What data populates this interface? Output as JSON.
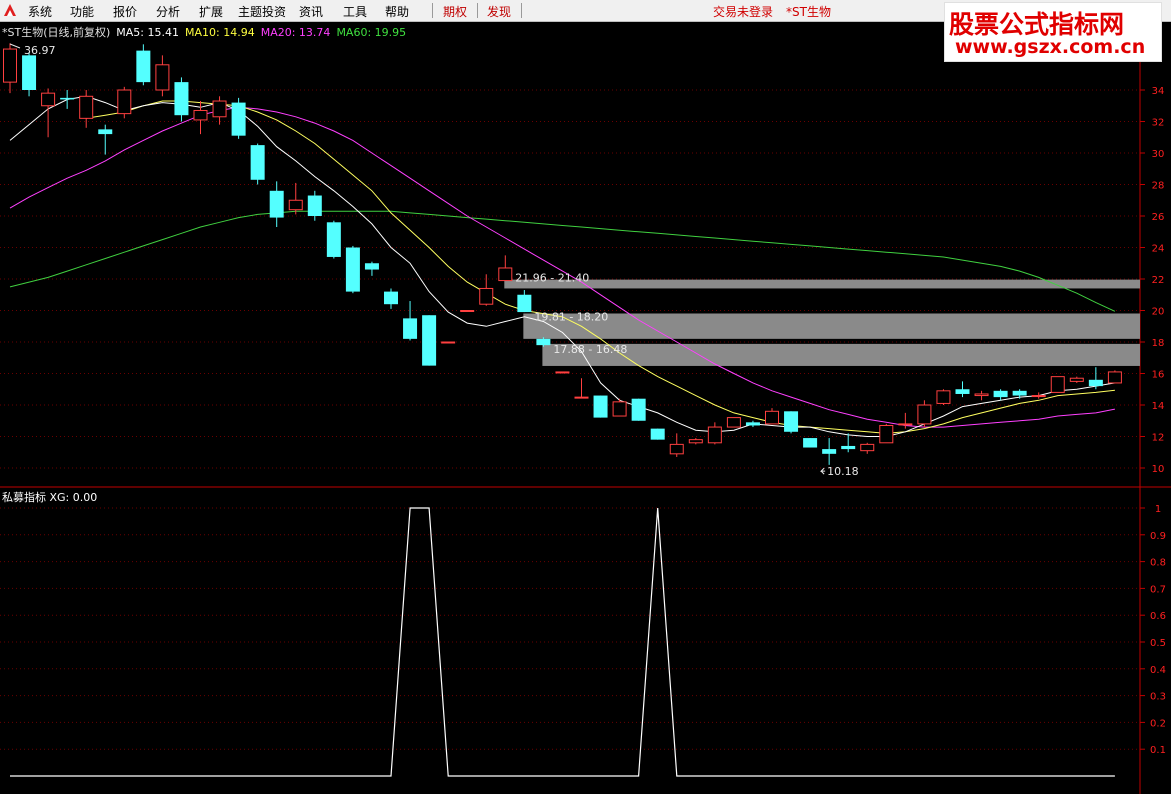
{
  "menu": {
    "items": [
      "系统",
      "功能",
      "报价",
      "分析",
      "扩展",
      "主题投资",
      "资讯",
      "工具",
      "帮助"
    ],
    "red_items": [
      "期权",
      "发现"
    ]
  },
  "status": {
    "trade": "交易未登录",
    "stock": "*ST生物"
  },
  "brand": {
    "line1": "股票公式指标网",
    "line2": "www.gszx.com.cn"
  },
  "main_legend": {
    "title": "*ST生物(日线,前复权)",
    "ma5": "MA5: 15.41",
    "ma10": "MA10: 14.94",
    "ma20": "MA20: 13.74",
    "ma60": "MA60: 19.95"
  },
  "sub_legend": {
    "title": "私募指标",
    "xg": "XG: 0.00"
  },
  "annotations": {
    "high": "36.97",
    "low": "10.18",
    "gap1": "21.96 - 21.40",
    "gap2": "19.81 - 18.20",
    "gap3": "17.88 - 16.48"
  },
  "colors": {
    "up": "#ff4040",
    "down": "#54ffff",
    "ma5": "#ffffff",
    "ma10": "#ffff60",
    "ma20": "#ff40ff",
    "ma60": "#40d040",
    "axis": "#c00000",
    "gap_box": "#8a8a8a"
  },
  "chart_data": {
    "type": "candlestick",
    "y_ticks": [
      10,
      12,
      14,
      16,
      18,
      20,
      22,
      24,
      26,
      28,
      30,
      32,
      34
    ],
    "sub_y_ticks": [
      1,
      0.9,
      0.8,
      0.7,
      0.6,
      0.5,
      0.4,
      0.3,
      0.2,
      0.1
    ],
    "candles": [
      [
        34.5,
        36.6,
        33.8,
        36.97
      ],
      [
        36.2,
        34.0,
        33.6,
        36.4
      ],
      [
        33.0,
        33.8,
        31.0,
        34.1
      ],
      [
        33.5,
        33.4,
        32.8,
        34.0
      ],
      [
        32.2,
        33.6,
        31.6,
        34.0
      ],
      [
        31.5,
        31.2,
        29.9,
        31.8
      ],
      [
        32.5,
        34.0,
        32.2,
        34.2
      ],
      [
        36.5,
        34.5,
        34.3,
        36.9
      ],
      [
        34.0,
        35.6,
        33.6,
        36.2
      ],
      [
        34.5,
        32.4,
        32.0,
        34.8
      ],
      [
        32.1,
        32.7,
        31.2,
        33.3
      ],
      [
        32.3,
        33.3,
        31.8,
        33.6
      ],
      [
        33.2,
        31.1,
        30.9,
        33.5
      ],
      [
        30.5,
        28.3,
        28.0,
        30.6
      ],
      [
        27.6,
        25.9,
        25.3,
        28.2
      ],
      [
        26.4,
        27.0,
        26.1,
        28.1
      ],
      [
        27.3,
        26.0,
        25.7,
        27.6
      ],
      [
        25.6,
        23.4,
        23.3,
        25.7
      ],
      [
        24.0,
        21.2,
        21.1,
        24.1
      ],
      [
        23.0,
        22.6,
        22.2,
        23.1
      ],
      [
        21.2,
        20.4,
        20.1,
        21.4
      ],
      [
        19.5,
        18.2,
        18.1,
        20.6
      ],
      [
        19.7,
        16.5,
        16.5,
        19.7
      ],
      [
        18.0,
        18.0,
        18.0,
        18.0
      ],
      [
        20.0,
        20.0,
        20.0,
        20.0
      ],
      [
        20.4,
        21.4,
        20.3,
        22.3
      ],
      [
        21.9,
        22.7,
        21.9,
        23.5
      ],
      [
        21.0,
        19.9,
        19.9,
        21.3
      ],
      [
        18.2,
        17.8,
        17.7,
        18.3
      ],
      [
        16.1,
        16.1,
        16.0,
        16.1
      ],
      [
        14.5,
        14.5,
        14.5,
        15.7
      ],
      [
        14.6,
        13.2,
        13.2,
        14.6
      ],
      [
        13.3,
        14.2,
        13.3,
        14.4
      ],
      [
        14.4,
        13.0,
        13.0,
        14.4
      ],
      [
        12.5,
        11.8,
        11.8,
        12.5
      ],
      [
        10.9,
        11.5,
        10.7,
        12.2
      ],
      [
        11.6,
        11.8,
        11.5,
        11.9
      ],
      [
        11.6,
        12.6,
        11.5,
        12.9
      ],
      [
        12.6,
        13.2,
        12.6,
        13.2
      ],
      [
        12.9,
        12.7,
        12.6,
        13.0
      ],
      [
        12.8,
        13.6,
        12.8,
        13.8
      ],
      [
        13.6,
        12.3,
        12.2,
        13.6
      ],
      [
        11.9,
        11.3,
        11.3,
        11.9
      ],
      [
        11.2,
        10.9,
        10.2,
        11.9
      ],
      [
        11.4,
        11.2,
        11.0,
        12.2
      ],
      [
        11.1,
        11.5,
        10.9,
        11.6
      ],
      [
        11.6,
        12.7,
        11.6,
        12.8
      ],
      [
        12.8,
        12.8,
        12.5,
        13.5
      ],
      [
        12.8,
        14.0,
        12.6,
        14.3
      ],
      [
        14.1,
        14.9,
        14.0,
        15.0
      ],
      [
        15.0,
        14.7,
        14.5,
        15.5
      ],
      [
        14.6,
        14.7,
        14.3,
        14.9
      ],
      [
        14.9,
        14.5,
        14.3,
        15.0
      ],
      [
        14.9,
        14.6,
        14.4,
        15.0
      ],
      [
        14.6,
        14.6,
        14.4,
        14.8
      ],
      [
        14.8,
        15.8,
        14.8,
        15.8
      ],
      [
        15.5,
        15.7,
        15.4,
        15.8
      ],
      [
        15.6,
        15.2,
        15.0,
        16.4
      ],
      [
        15.4,
        16.1,
        15.4,
        16.2
      ]
    ],
    "ma5": [
      30.8,
      31.8,
      32.8,
      33.4,
      33.6,
      33.2,
      32.7,
      33.0,
      33.2,
      33.1,
      32.9,
      33.2,
      32.7,
      31.7,
      30.4,
      29.5,
      28.5,
      27.6,
      26.6,
      25.5,
      24.0,
      23.0,
      21.2,
      19.9,
      19.2,
      19.0,
      19.3,
      19.6,
      19.3,
      18.6,
      17.4,
      15.4,
      14.3,
      13.9,
      13.5,
      12.9,
      12.4,
      12.3,
      12.4,
      12.8,
      12.7,
      12.6,
      12.6,
      12.3,
      12.1,
      12.0,
      12.0,
      12.3,
      12.8,
      13.3,
      13.9,
      14.1,
      14.3,
      14.5,
      14.6,
      14.9,
      15.0,
      15.2,
      15.4
    ],
    "ma10": [
      null,
      null,
      null,
      null,
      32.2,
      32.4,
      32.6,
      33.0,
      33.3,
      33.3,
      33.2,
      33.1,
      33.0,
      32.6,
      32.1,
      31.4,
      30.6,
      29.6,
      28.6,
      27.6,
      26.2,
      25.1,
      24.0,
      22.8,
      21.8,
      21.1,
      20.4,
      20.0,
      19.8,
      19.6,
      19.0,
      18.2,
      17.3,
      16.5,
      15.8,
      15.2,
      14.6,
      14.0,
      13.5,
      13.2,
      12.9,
      12.7,
      12.6,
      12.5,
      12.4,
      12.3,
      12.2,
      12.3,
      12.5,
      12.8,
      13.2,
      13.5,
      13.8,
      14.1,
      14.3,
      14.6,
      14.7,
      14.8,
      14.94
    ],
    "ma20": [
      26.5,
      27.2,
      27.8,
      28.4,
      28.9,
      29.5,
      30.2,
      30.8,
      31.4,
      31.9,
      32.4,
      32.7,
      32.9,
      32.8,
      32.6,
      32.3,
      31.9,
      31.4,
      30.8,
      30.0,
      29.2,
      28.4,
      27.6,
      26.8,
      26.0,
      25.3,
      24.6,
      23.9,
      23.2,
      22.5,
      21.8,
      21.0,
      20.2,
      19.4,
      18.7,
      18.0,
      17.3,
      16.6,
      16.0,
      15.4,
      14.9,
      14.5,
      14.1,
      13.7,
      13.4,
      13.1,
      12.9,
      12.7,
      12.6,
      12.6,
      12.7,
      12.8,
      12.9,
      13.0,
      13.1,
      13.3,
      13.4,
      13.5,
      13.74
    ],
    "ma60": [
      21.5,
      21.8,
      22.1,
      22.5,
      22.9,
      23.3,
      23.7,
      24.1,
      24.5,
      24.9,
      25.3,
      25.6,
      25.9,
      26.1,
      26.2,
      26.3,
      26.3,
      26.3,
      26.3,
      26.3,
      26.3,
      26.2,
      26.1,
      26.0,
      25.9,
      25.8,
      25.7,
      25.6,
      25.5,
      25.4,
      25.3,
      25.2,
      25.1,
      25.0,
      24.9,
      24.8,
      24.7,
      24.6,
      24.5,
      24.4,
      24.3,
      24.2,
      24.1,
      24.0,
      23.9,
      23.8,
      23.7,
      23.6,
      23.5,
      23.4,
      23.2,
      23.0,
      22.8,
      22.5,
      22.1,
      21.6,
      21.1,
      20.5,
      19.95
    ],
    "xg": [
      0,
      0,
      0,
      0,
      0,
      0,
      0,
      0,
      0,
      0,
      0,
      0,
      0,
      0,
      0,
      0,
      0,
      0,
      0,
      0,
      0,
      1,
      1,
      0,
      0,
      0,
      0,
      0,
      0,
      0,
      0,
      0,
      0,
      0,
      1,
      0,
      0,
      0,
      0,
      0,
      0,
      0,
      0,
      0,
      0,
      0,
      0,
      0,
      0,
      0,
      0,
      0,
      0,
      0,
      0,
      0,
      0,
      0,
      0
    ],
    "gaps": [
      [
        21.96,
        21.4
      ],
      [
        19.81,
        18.2
      ],
      [
        17.88,
        16.48
      ]
    ]
  }
}
